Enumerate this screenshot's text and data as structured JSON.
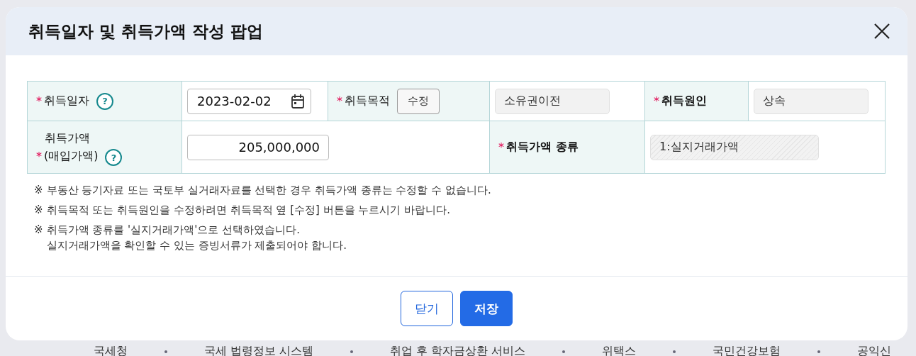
{
  "dialog": {
    "title": "취득일자 및 취득가액 작성 팝업"
  },
  "date_field": {
    "label": "취득일자",
    "required_mark": "*",
    "help": "?",
    "value": "2023-02-02"
  },
  "purpose_field": {
    "label": "취득목적",
    "required_mark": "*",
    "edit_button": "수정",
    "value": "소유권이전",
    "readonly": true
  },
  "cause_field": {
    "label": "취득원인",
    "required_mark": "*",
    "value": "상속",
    "readonly": true
  },
  "price_field": {
    "label_lines": [
      "취득가액",
      "(매입가액)"
    ],
    "required_mark": "*",
    "help": "?",
    "value": "205,000,000"
  },
  "price_type_field": {
    "label": "취득가액 종류",
    "required_mark": "*",
    "value": "1:실지거래가액",
    "disabled": true
  },
  "notes": [
    {
      "marker": "※",
      "lines": [
        "부동산 등기자료 또는 국토부 실거래자료를 선택한 경우 취득가액 종류는 수정할 수 없습니다."
      ]
    },
    {
      "marker": "※",
      "lines": [
        "취득목적 또는 취득원인을 수정하려면 취득목적 옆 [수정] 버튼을 누르시기 바랍니다."
      ]
    },
    {
      "marker": "※",
      "lines": [
        "취득가액 종류를 '실지거래가액'으로 선택하였습니다.",
        "실지거래가액을 확인할 수 있는 증빙서류가 제출되어야 합니다."
      ]
    }
  ],
  "buttons": [
    {
      "label": "닫기",
      "kind": "secondary"
    },
    {
      "label": "저장",
      "kind": "primary"
    }
  ],
  "footer_links": [
    "국세청",
    "국세 법령정보 시스템",
    "취업 후 학자금상환 서비스",
    "위택스",
    "국민건강보험",
    "공익신"
  ]
}
